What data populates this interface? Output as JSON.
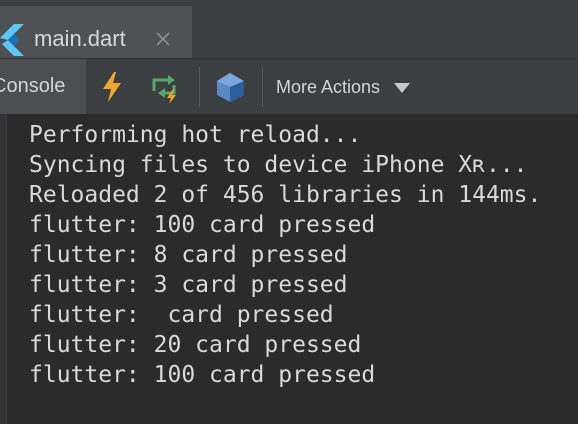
{
  "tab": {
    "label": "main.dart",
    "icon": "flutter-logo-icon",
    "close_icon": "close-icon"
  },
  "toolbar": {
    "console_label": "Console",
    "hot_reload_icon": "lightning-icon",
    "hot_restart_icon": "restart-icon",
    "devtools_icon": "dart-devtools-icon",
    "more_actions_label": "More Actions"
  },
  "console": {
    "lines": [
      "Performing hot reload...",
      "Syncing files to device iPhone Xʀ...",
      "Reloaded 2 of 456 libraries in 144ms.",
      "flutter: 100 card pressed",
      "flutter: 8 card pressed",
      "flutter: 3 card pressed",
      "flutter:  card pressed",
      "flutter: 20 card pressed",
      "flutter: 100 card pressed"
    ]
  },
  "colors": {
    "background": "#2b2b2b",
    "toolbar": "#3c3f41",
    "active_tab": "#4e5254",
    "text": "#d9d9d9",
    "lightning": "#f0a732",
    "restart_green": "#59a869",
    "flutter_blue": "#5ec7f8"
  }
}
